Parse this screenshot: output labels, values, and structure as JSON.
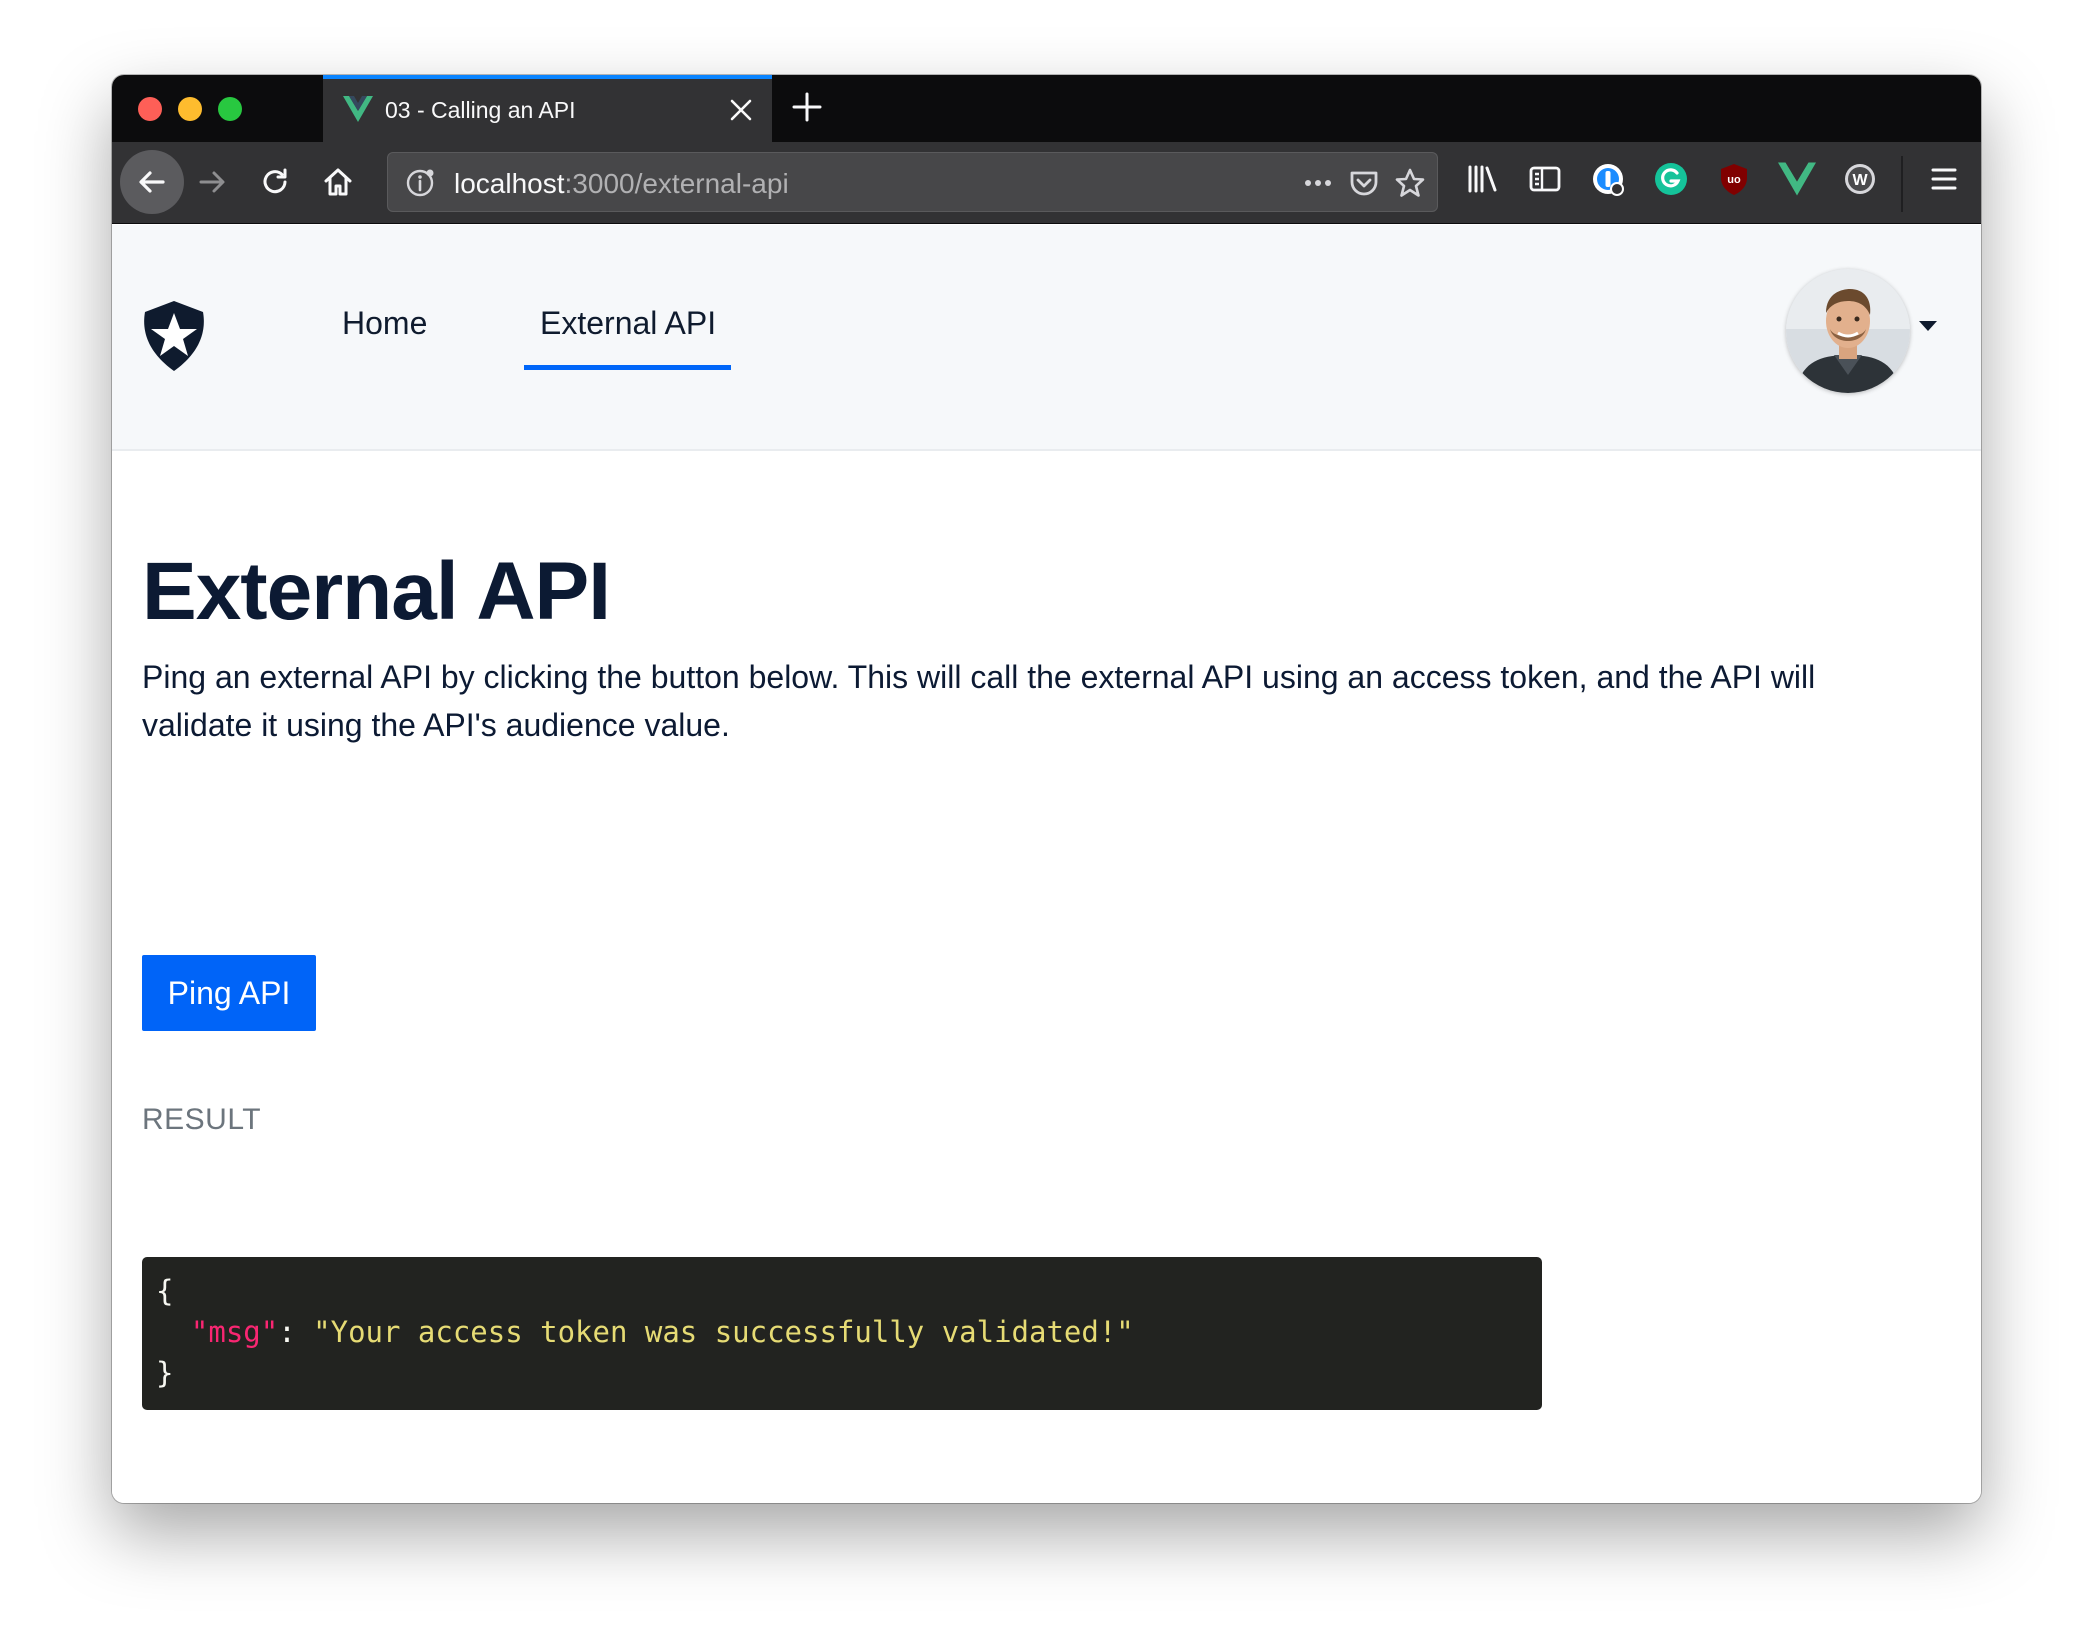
{
  "browser": {
    "tab": {
      "title": "03 - Calling an API",
      "favicon": "vue-logo-icon"
    },
    "url": {
      "host": "localhost",
      "rest": ":3000/external-api"
    },
    "extensions": [
      "library-icon",
      "sidebar-icon",
      "1password-icon",
      "grammarly-icon",
      "ublock-icon",
      "vue-devtools-icon",
      "wappalyzer-icon"
    ],
    "colors": {
      "chrome_dark": "#0c0c0d",
      "toolbar": "#323234",
      "tab_highlight": "#0a84ff"
    }
  },
  "navbar": {
    "logo": "auth0-logo",
    "links": [
      {
        "label": "Home",
        "active": false
      },
      {
        "label": "External API",
        "active": true
      }
    ],
    "avatar": "user-avatar"
  },
  "main": {
    "title": "External API",
    "description": "Ping an external API by clicking the button below. This will call the external API using an access token, and the API will validate it using the API's audience value.",
    "ping_button": "Ping API",
    "result_label": "RESULT",
    "result": {
      "open": "{",
      "key": "\"msg\"",
      "sep": ": ",
      "value": "\"Your access token was successfully validated!\"",
      "close": "}"
    }
  },
  "theme": {
    "primary": "#0064f8",
    "code_bg": "#222320",
    "code_key": "#f92672",
    "code_string": "#e6db74"
  }
}
